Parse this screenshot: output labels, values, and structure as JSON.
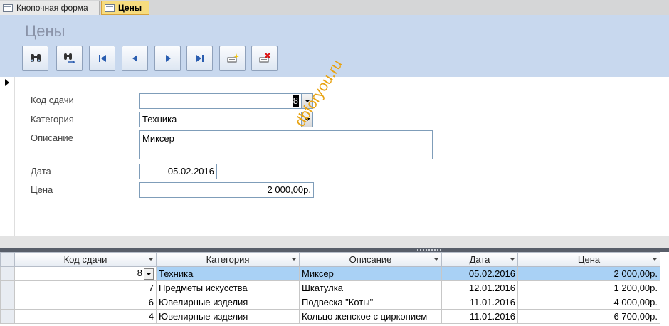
{
  "tabs": [
    {
      "label": "Кнопочная форма",
      "active": false
    },
    {
      "label": "Цены",
      "active": true
    }
  ],
  "form": {
    "title": "Цены",
    "toolbar": [
      {
        "name": "find-button",
        "icon": "binoculars-icon"
      },
      {
        "name": "find-next-button",
        "icon": "binoculars-next-icon"
      },
      {
        "name": "first-record-button",
        "icon": "first-record-icon"
      },
      {
        "name": "previous-record-button",
        "icon": "previous-record-icon"
      },
      {
        "name": "next-record-button",
        "icon": "next-record-icon"
      },
      {
        "name": "last-record-button",
        "icon": "last-record-icon"
      },
      {
        "name": "new-record-button",
        "icon": "new-record-icon"
      },
      {
        "name": "delete-record-button",
        "icon": "delete-record-icon"
      }
    ],
    "fields": {
      "code_label": "Код сдачи",
      "code_value": "8",
      "category_label": "Категория",
      "category_value": "Техника",
      "description_label": "Описание",
      "description_value": "Миксер",
      "date_label": "Дата",
      "date_value": "05.02.2016",
      "price_label": "Цена",
      "price_value": "2 000,00р."
    },
    "watermark": "dbforyou.ru"
  },
  "grid": {
    "columns": [
      "Код сдачи",
      "Категория",
      "Описание",
      "Дата",
      "Цена"
    ],
    "rows": [
      {
        "code": "8",
        "category": "Техника",
        "description": "Миксер",
        "date": "05.02.2016",
        "price": "2 000,00р."
      },
      {
        "code": "7",
        "category": "Предметы искусства",
        "description": "Шкатулка",
        "date": "12.01.2016",
        "price": "1 200,00р."
      },
      {
        "code": "6",
        "category": "Ювелирные изделия",
        "description": "Подвеска \"Коты\"",
        "date": "11.01.2016",
        "price": "4 000,00р."
      },
      {
        "code": "4",
        "category": "Ювелирные изделия",
        "description": "Кольцо женское с цирконием",
        "date": "11.01.2016",
        "price": "6 700,00р."
      }
    ]
  },
  "colors": {
    "header_bg": "#c8d8ee",
    "active_tab": "#f7dc7e",
    "selected_row": "#a9d1f5",
    "watermark": "#e8a312"
  }
}
